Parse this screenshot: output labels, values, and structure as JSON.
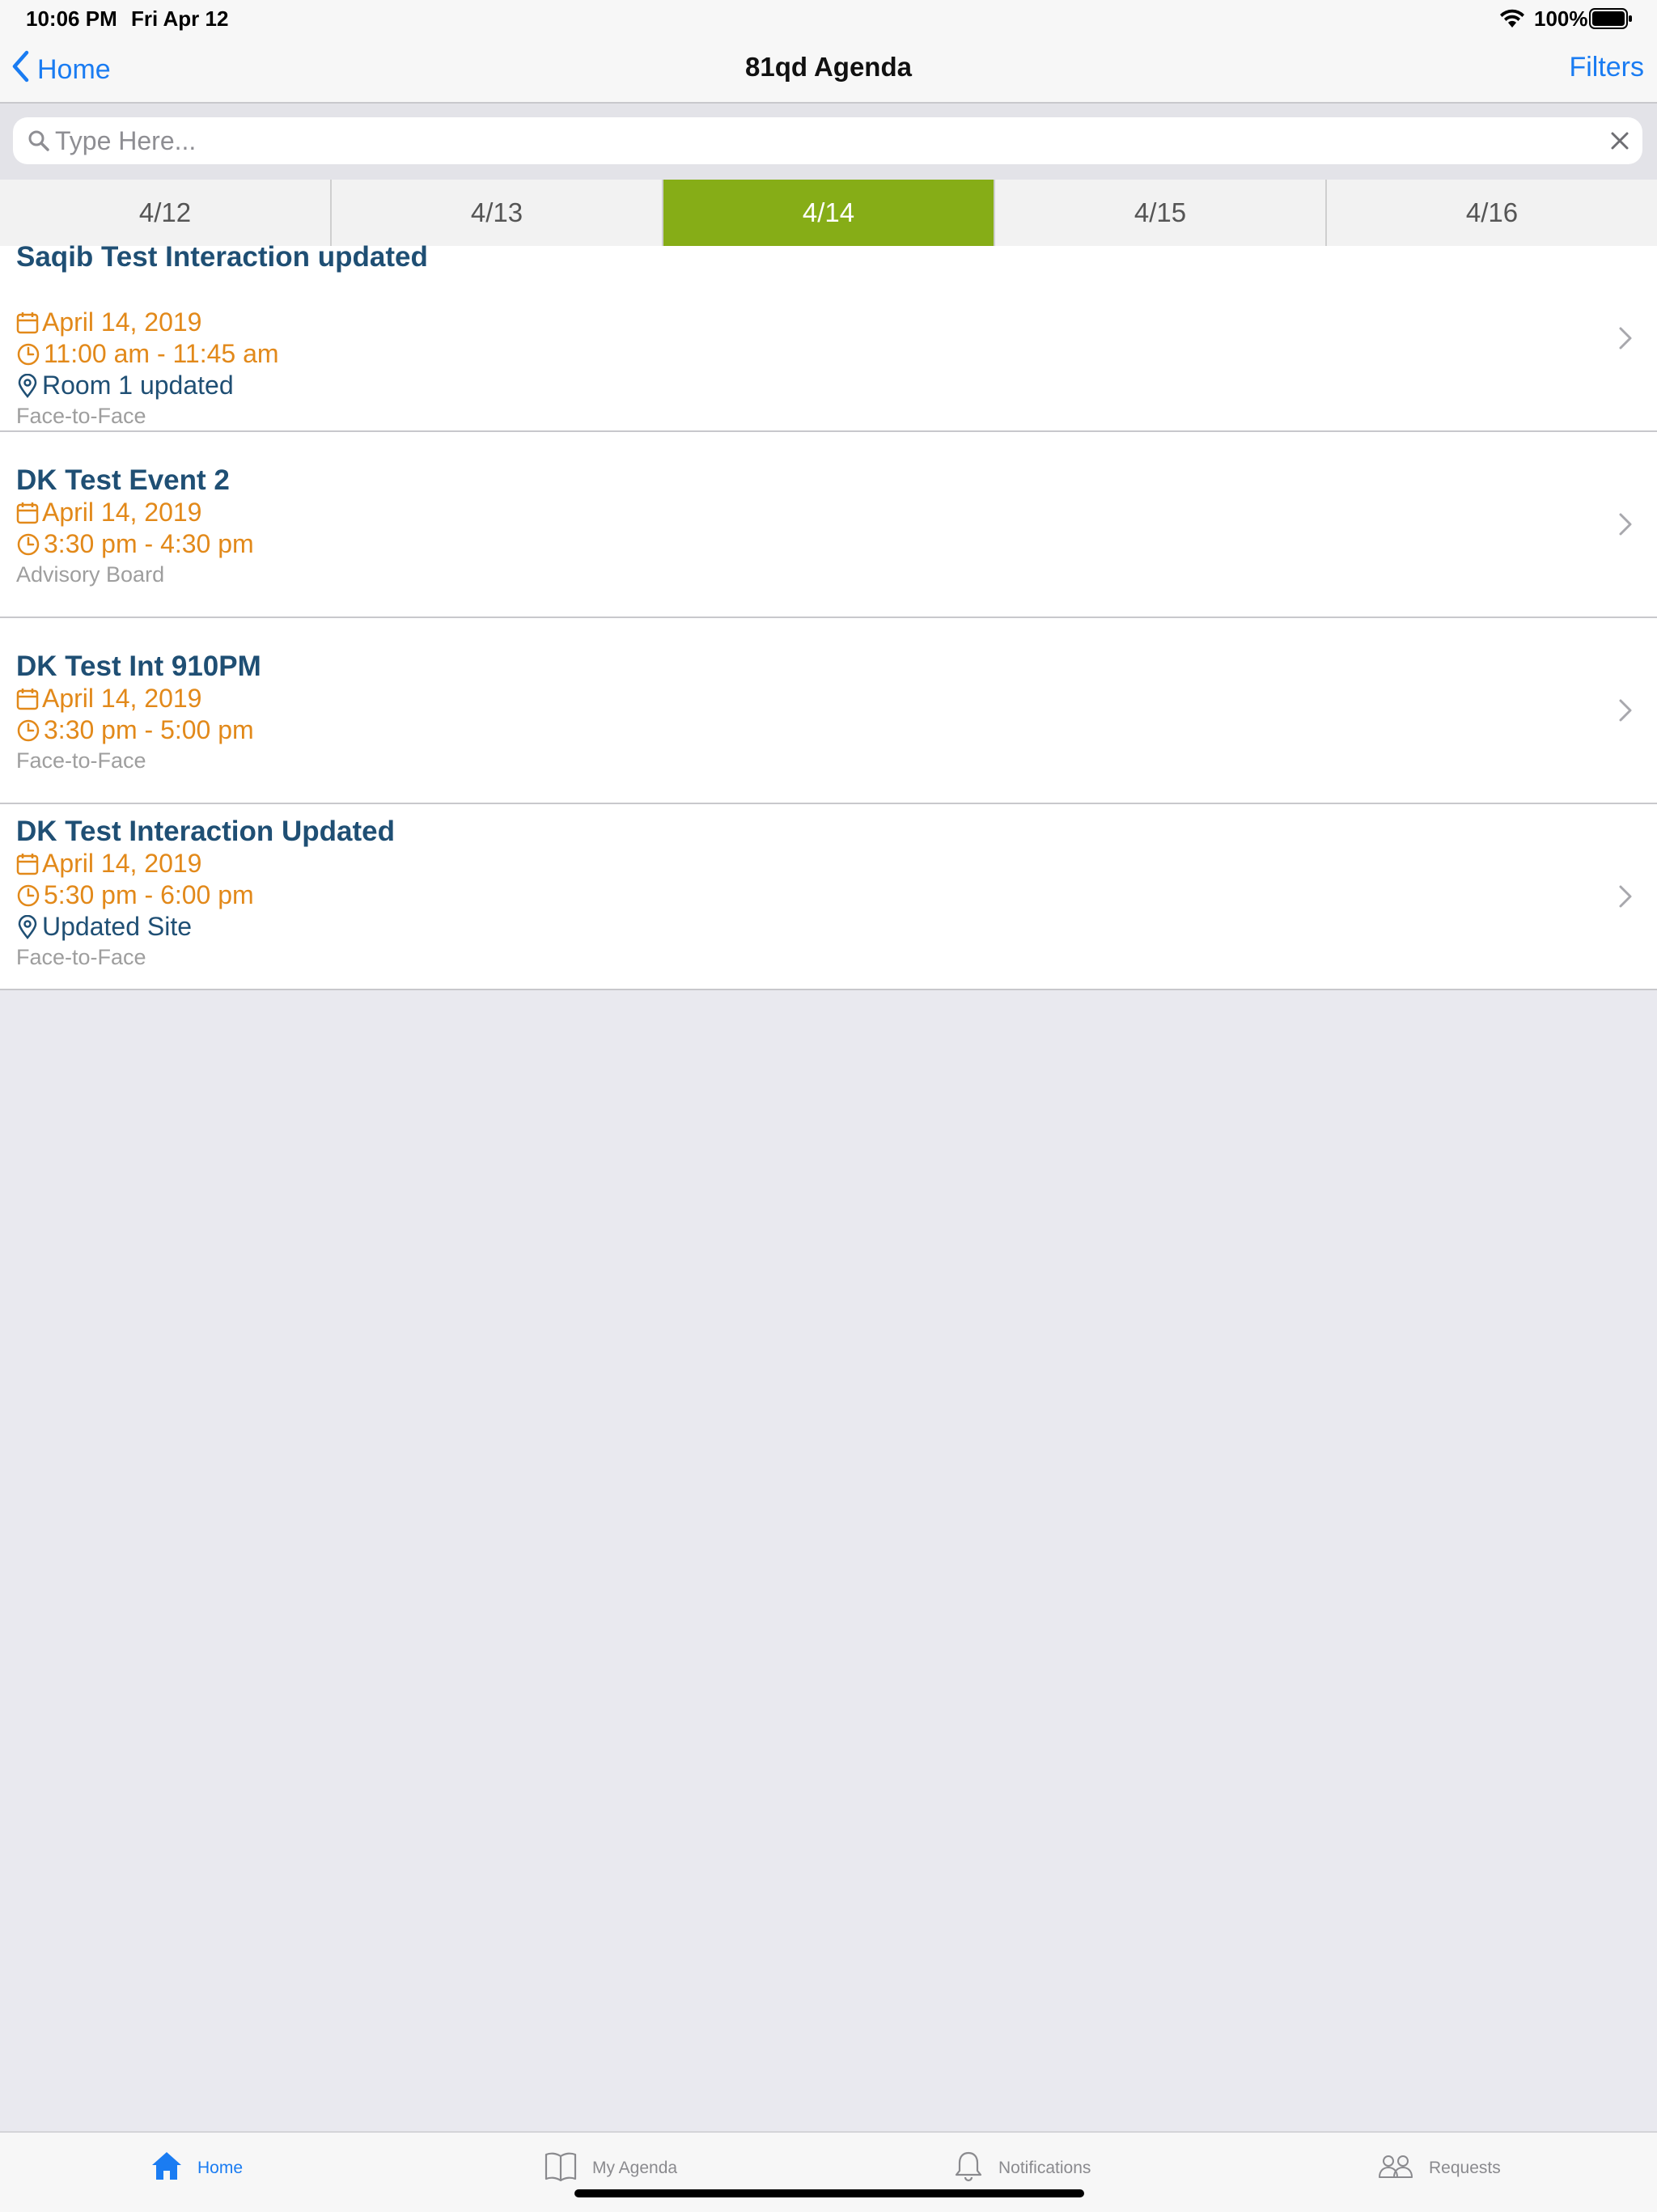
{
  "status_bar": {
    "time": "10:06 PM",
    "date": "Fri Apr 12",
    "battery": "100%",
    "icons": [
      "wifi-icon",
      "battery-icon"
    ]
  },
  "nav": {
    "back_label": "Home",
    "title": "81qd Agenda",
    "filters_label": "Filters",
    "accent_color": "#1a7cf2"
  },
  "search": {
    "placeholder": "Type Here...",
    "value": ""
  },
  "date_tabs": [
    {
      "label": "4/12",
      "selected": false
    },
    {
      "label": "4/13",
      "selected": false
    },
    {
      "label": "4/14",
      "selected": true
    },
    {
      "label": "4/15",
      "selected": false
    },
    {
      "label": "4/16",
      "selected": false
    }
  ],
  "selected_tab_color": "#86ad17",
  "events": [
    {
      "title": "Saqib Test Interaction updated",
      "date": "April 14, 2019",
      "time": "11:00 am - 11:45 am",
      "location": "Room 1 updated",
      "type": "Face-to-Face"
    },
    {
      "title": "DK Test Event 2",
      "date": "April 14, 2019",
      "time": "3:30 pm - 4:30 pm",
      "type": "Advisory Board"
    },
    {
      "title": "DK Test Int 910PM",
      "date": "April 14, 2019",
      "time": "3:30 pm - 5:00 pm",
      "type": "Face-to-Face"
    },
    {
      "title": "DK Test Interaction Updated",
      "date": "April 14, 2019",
      "time": "5:30 pm - 6:00 pm",
      "location": "Updated Site",
      "type": "Face-to-Face"
    }
  ],
  "colors": {
    "title": "#1f4f74",
    "date_time": "#e2891a",
    "type": "#9e9e9e"
  },
  "tab_bar": [
    {
      "label": "Home",
      "icon": "home-icon",
      "active": true
    },
    {
      "label": "My Agenda",
      "icon": "book-icon",
      "active": false
    },
    {
      "label": "Notifications",
      "icon": "bell-icon",
      "active": false
    },
    {
      "label": "Requests",
      "icon": "people-icon",
      "active": false
    }
  ]
}
